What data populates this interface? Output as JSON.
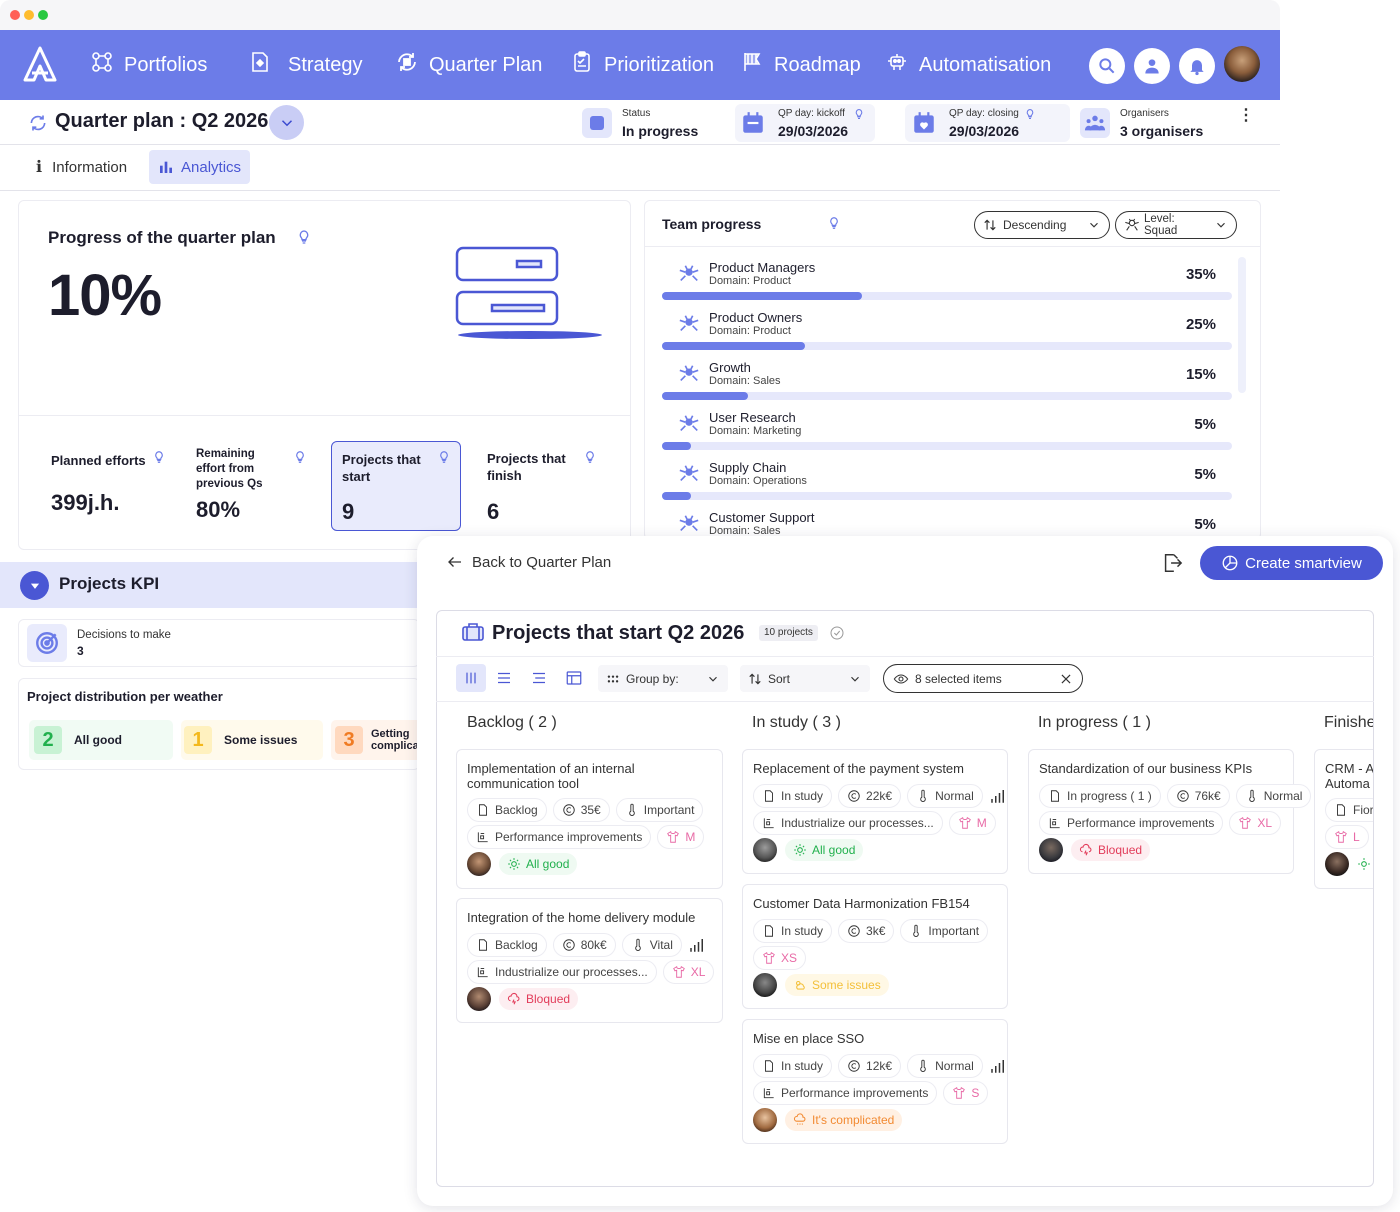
{
  "nav": {
    "items": [
      {
        "label": "Portfolios",
        "icon": "portfolios-icon"
      },
      {
        "label": "Strategy",
        "icon": "strategy-icon"
      },
      {
        "label": "Quarter Plan",
        "icon": "quarter-plan-icon"
      },
      {
        "label": "Prioritization",
        "icon": "prioritization-icon"
      },
      {
        "label": "Roadmap",
        "icon": "roadmap-flag-icon"
      },
      {
        "label": "Automatisation",
        "icon": "robot-icon"
      }
    ],
    "brand_color": "#6c7ce8"
  },
  "header": {
    "title": "Quarter plan : Q2 2026",
    "status_label": "Status",
    "status_value": "In progress",
    "kickoff_label": "QP day: kickoff",
    "kickoff_value": "29/03/2026",
    "closing_label": "QP day: closing",
    "closing_value": "29/03/2026",
    "organisers_label": "Organisers",
    "organisers_value": "3 organisers"
  },
  "tabs": [
    {
      "label": "Information",
      "active": false
    },
    {
      "label": "Analytics",
      "active": true
    }
  ],
  "progress": {
    "title": "Progress of the quarter plan",
    "value": "10%",
    "stats": [
      {
        "label": "Planned efforts",
        "value": "399j.h."
      },
      {
        "label": "Remaining effort from previous Qs",
        "value": "80%"
      },
      {
        "label": "Projects that start",
        "value": "9"
      },
      {
        "label": "Projects that finish",
        "value": "6"
      }
    ]
  },
  "team_progress": {
    "title": "Team progress",
    "sort": "Descending",
    "level": "Level: Squad",
    "rows": [
      {
        "name": "Product Managers",
        "domain": "Domain: Product",
        "pct": "35%",
        "value": 0.35
      },
      {
        "name": "Product Owners",
        "domain": "Domain: Product",
        "pct": "25%",
        "value": 0.25
      },
      {
        "name": "Growth",
        "domain": "Domain:  Sales",
        "pct": "15%",
        "value": 0.15
      },
      {
        "name": "User Research",
        "domain": "Domain:  Marketing",
        "pct": "5%",
        "value": 0.05
      },
      {
        "name": "Supply Chain",
        "domain": "Domain:  Operations",
        "pct": "5%",
        "value": 0.05
      },
      {
        "name": "Customer Support",
        "domain": "Domain: Sales",
        "pct": "5%",
        "value": 0.05
      }
    ]
  },
  "kpi": {
    "title": "Projects KPI",
    "decisions_label": "Decisions to make",
    "decisions_value": "3",
    "weather_title": "Project distribution per weather",
    "weather": [
      {
        "count": "2",
        "label": "All good"
      },
      {
        "count": "1",
        "label": "Some issues"
      },
      {
        "count": "3",
        "label": "Getting complicated"
      }
    ]
  },
  "overlay": {
    "back": "Back to Quarter Plan",
    "create": "Create smartview",
    "title": "Projects that start Q2 2026",
    "count_badge": "10 projects",
    "group_by": "Group by:",
    "sort": "Sort",
    "filter": "8 selected items",
    "columns": [
      {
        "title": "Backlog ( 2 )"
      },
      {
        "title": "In study ( 3 )"
      },
      {
        "title": "In progress ( 1 )"
      },
      {
        "title": "Finished"
      }
    ],
    "cards": [
      {
        "title": "Implementation of an internal communication tool",
        "status": "Backlog",
        "cost": "35€",
        "priority": "Important",
        "objective": "Performance improvements",
        "size": "M",
        "weather": "All good"
      },
      {
        "title": "Integration of the home delivery module",
        "status": "Backlog",
        "cost": "80k€",
        "priority": "Vital",
        "objective": "Industrialize our processes...",
        "size": "XL",
        "weather": "Bloqued"
      },
      {
        "title": "Replacement of the payment system",
        "status": "In study",
        "cost": "22k€",
        "priority": "Normal",
        "objective": "Industrialize our processes...",
        "size": "M",
        "weather": "All good"
      },
      {
        "title": "Customer Data Harmonization FB154",
        "status": "In study",
        "cost": "3k€",
        "priority": "Important",
        "size": "XS",
        "weather": "Some issues"
      },
      {
        "title": "Mise en place SSO",
        "status": "In study",
        "cost": "12k€",
        "priority": "Normal",
        "objective": "Performance improvements",
        "size": "S",
        "weather": "It's complicated"
      },
      {
        "title": "Standardization of our business KPIs",
        "status": "In progress ( 1 )",
        "cost": "76k€",
        "priority": "Normal",
        "objective": "Performance improvements",
        "size": "XL",
        "weather": "Bloqued"
      },
      {
        "title": "CRM - A",
        "title2": "Automa",
        "chip": "Fior",
        "size": "L"
      }
    ]
  }
}
